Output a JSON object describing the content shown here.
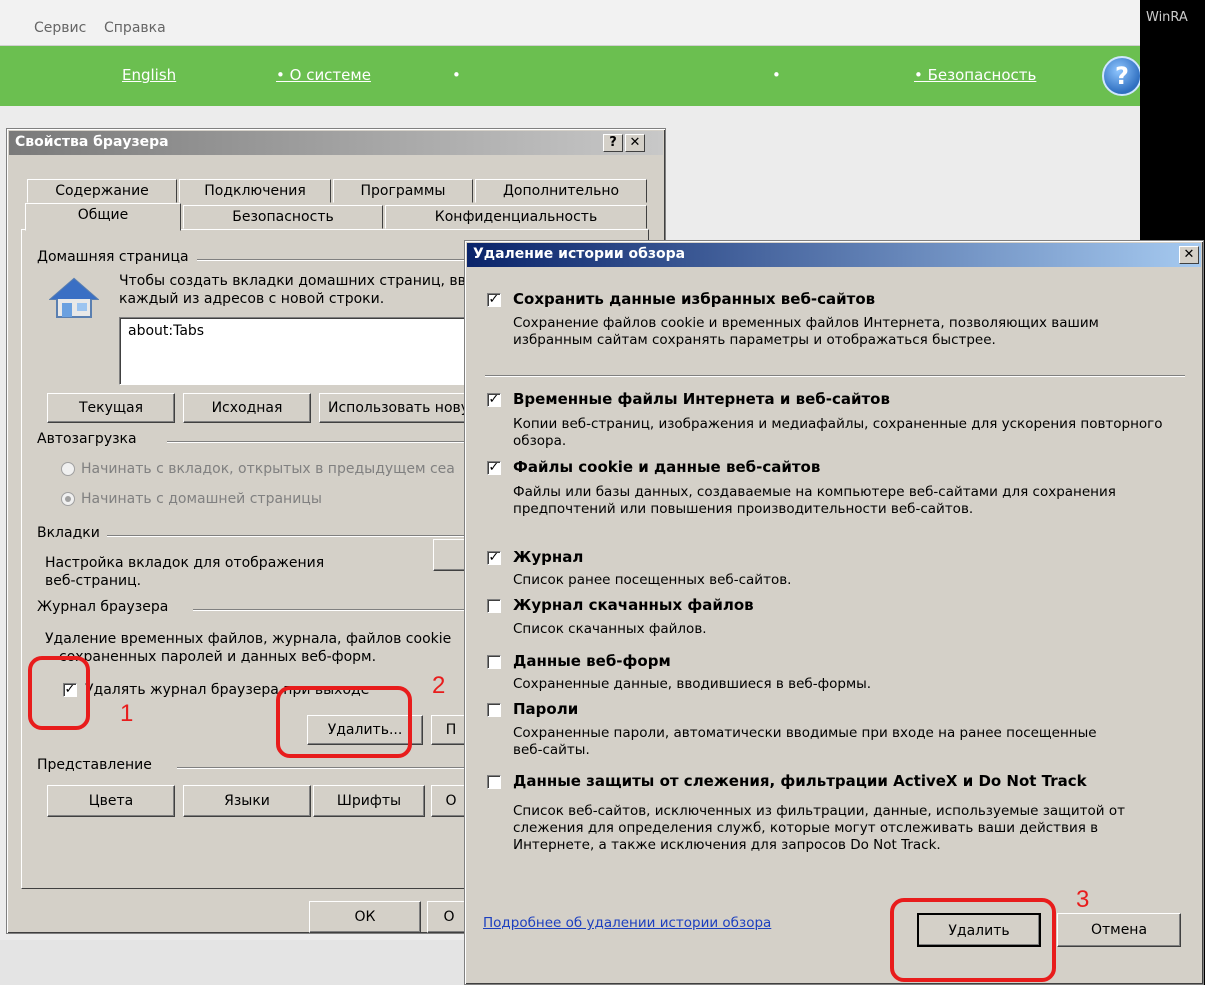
{
  "background": {
    "menu": [
      "Сервис",
      "Справка"
    ],
    "nav": [
      "English",
      "• О системе",
      "•",
      "•",
      "• Безопасность"
    ],
    "winrar": "WinRA",
    "help": "?"
  },
  "props_dialog": {
    "title": "Свойства браузера",
    "help_btn": "?",
    "close_btn": "✕",
    "tabs_row1": [
      "Содержание",
      "Подключения",
      "Программы",
      "Дополнительно"
    ],
    "tabs_row2": [
      "Общие",
      "Безопасность",
      "Конфиденциальность"
    ],
    "home_group": "Домашняя страница",
    "home_desc_1": "Чтобы создать вкладки домашних страниц, вв",
    "home_desc_2": "каждый из адресов с новой строки.",
    "home_value": "about:Tabs",
    "home_buttons": [
      "Текущая",
      "Исходная",
      "Использовать нову"
    ],
    "startup_group": "Автозагрузка",
    "startup_opt1": "Начинать с вкладок, открытых в предыдущем сеа",
    "startup_opt2": "Начинать с домашней страницы",
    "tabs_group": "Вкладки",
    "tabs_desc_1": "Настройка вкладок для отображения",
    "tabs_desc_2": "веб-страниц.",
    "history_group": "Журнал браузера",
    "history_desc_1": "Удаление временных файлов, журнала, файлов cookie",
    "history_desc_2": "сохраненных паролей и данных веб-форм.",
    "history_checkbox": "Удалять журнал браузера при выходе",
    "delete_btn": "Удалить...",
    "params_btn": "П",
    "view_group": "Представление",
    "view_buttons": [
      "Цвета",
      "Языки",
      "Шрифты",
      "О"
    ],
    "ok_btn": "ОК",
    "cancel_partial": "О"
  },
  "delete_dialog": {
    "title": "Удаление истории обзора",
    "close_btn": "✕",
    "items": [
      {
        "title": "Сохранить данные избранных веб-сайтов",
        "checked": true,
        "desc": [
          "Сохранение файлов cookie и временных файлов Интернета, позволяющих вашим",
          "избранным сайтам сохранять параметры и отображаться быстрее."
        ]
      },
      {
        "title": "Временные файлы Интернета и веб-сайтов",
        "checked": true,
        "desc": [
          "Копии веб-страниц, изображения и медиафайлы, сохраненные для ускорения повторного",
          "обзора."
        ]
      },
      {
        "title": "Файлы cookie и данные веб-сайтов",
        "checked": true,
        "desc": [
          "Файлы или базы данных, создаваемые на компьютере веб-сайтами для сохранения",
          "предпочтений или повышения производительности веб-сайтов."
        ]
      },
      {
        "title": "Журнал",
        "checked": true,
        "desc": [
          "Список ранее посещенных веб-сайтов."
        ]
      },
      {
        "title": "Журнал скачанных файлов",
        "checked": false,
        "desc": [
          "Список скачанных файлов."
        ]
      },
      {
        "title": "Данные веб-форм",
        "checked": false,
        "desc": [
          "Сохраненные данные, вводившиеся в веб-формы."
        ]
      },
      {
        "title": "Пароли",
        "checked": false,
        "desc": [
          "Сохраненные пароли, автоматически вводимые при входе на ранее посещенные",
          "веб-сайты."
        ]
      },
      {
        "title": "Данные защиты от слежения, фильтрации ActiveX и Do Not Track",
        "checked": false,
        "desc": [
          "Список веб-сайтов, исключенных из фильтрации, данные, используемые защитой от",
          "слежения для определения служб, которые могут отслеживать ваши действия в",
          "Интернете, а также исключения для запросов Do Not Track."
        ]
      }
    ],
    "link": "Подробнее об удалении истории обзора",
    "delete_btn": "Удалить",
    "cancel_btn": "Отмена"
  },
  "annotations": [
    "1",
    "2",
    "3"
  ],
  "colors": {
    "annotation": "#e81c1c",
    "green_nav": "#6bbf50",
    "dialog": "#d4d0c8"
  }
}
